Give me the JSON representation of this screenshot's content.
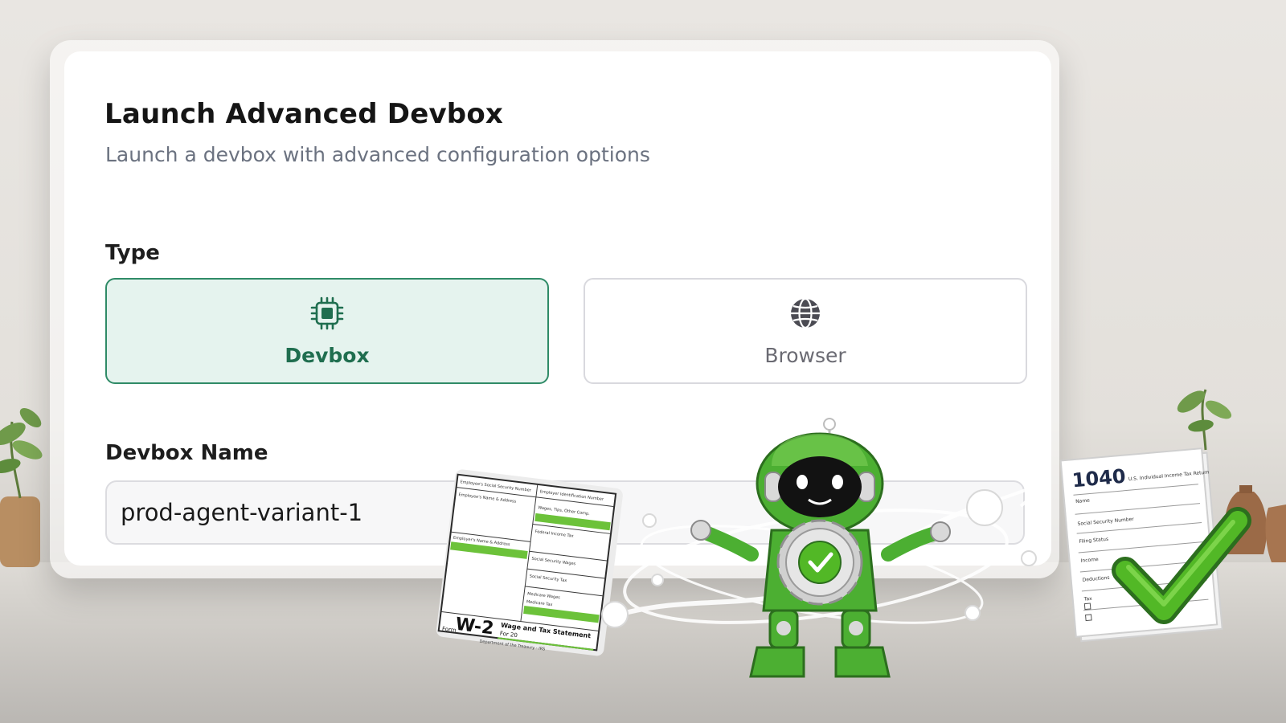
{
  "dialog": {
    "title": "Launch Advanced Devbox",
    "subtitle": "Launch a devbox with advanced configuration options",
    "type_label": "Type",
    "type_options": [
      {
        "label": "Devbox",
        "icon": "chip-icon",
        "selected": true
      },
      {
        "label": "Browser",
        "icon": "globe-icon",
        "selected": false
      }
    ],
    "name_label": "Devbox Name",
    "name_value": "prod-agent-variant-1"
  },
  "illustration": {
    "w2_form": {
      "code": "W-2",
      "title": "Wage and Tax Statement",
      "year": "For 20",
      "form_prefix": "Form",
      "department": "Department of the Treasury - IRS",
      "fields": [
        "Employee's Social Security Number",
        "Employer Identification Number",
        "Employee's Name & Address",
        "Wages, Tips, Other Comp.",
        "Federal Income Tax",
        "Employer's Name & Address",
        "Social Security Wages",
        "Social Security Tax",
        "Medicare Wages",
        "Medicare Tax"
      ]
    },
    "form_1040": {
      "code": "1040",
      "title": "U.S. Individual Income Tax Return",
      "fields": [
        "Name",
        "Social Security Number",
        "Filing Status",
        "Income",
        "Deductions",
        "Tax"
      ]
    },
    "colors": {
      "brand_green": "#2f8b67",
      "robot_green": "#4caf32",
      "check_green": "#52b826"
    }
  }
}
